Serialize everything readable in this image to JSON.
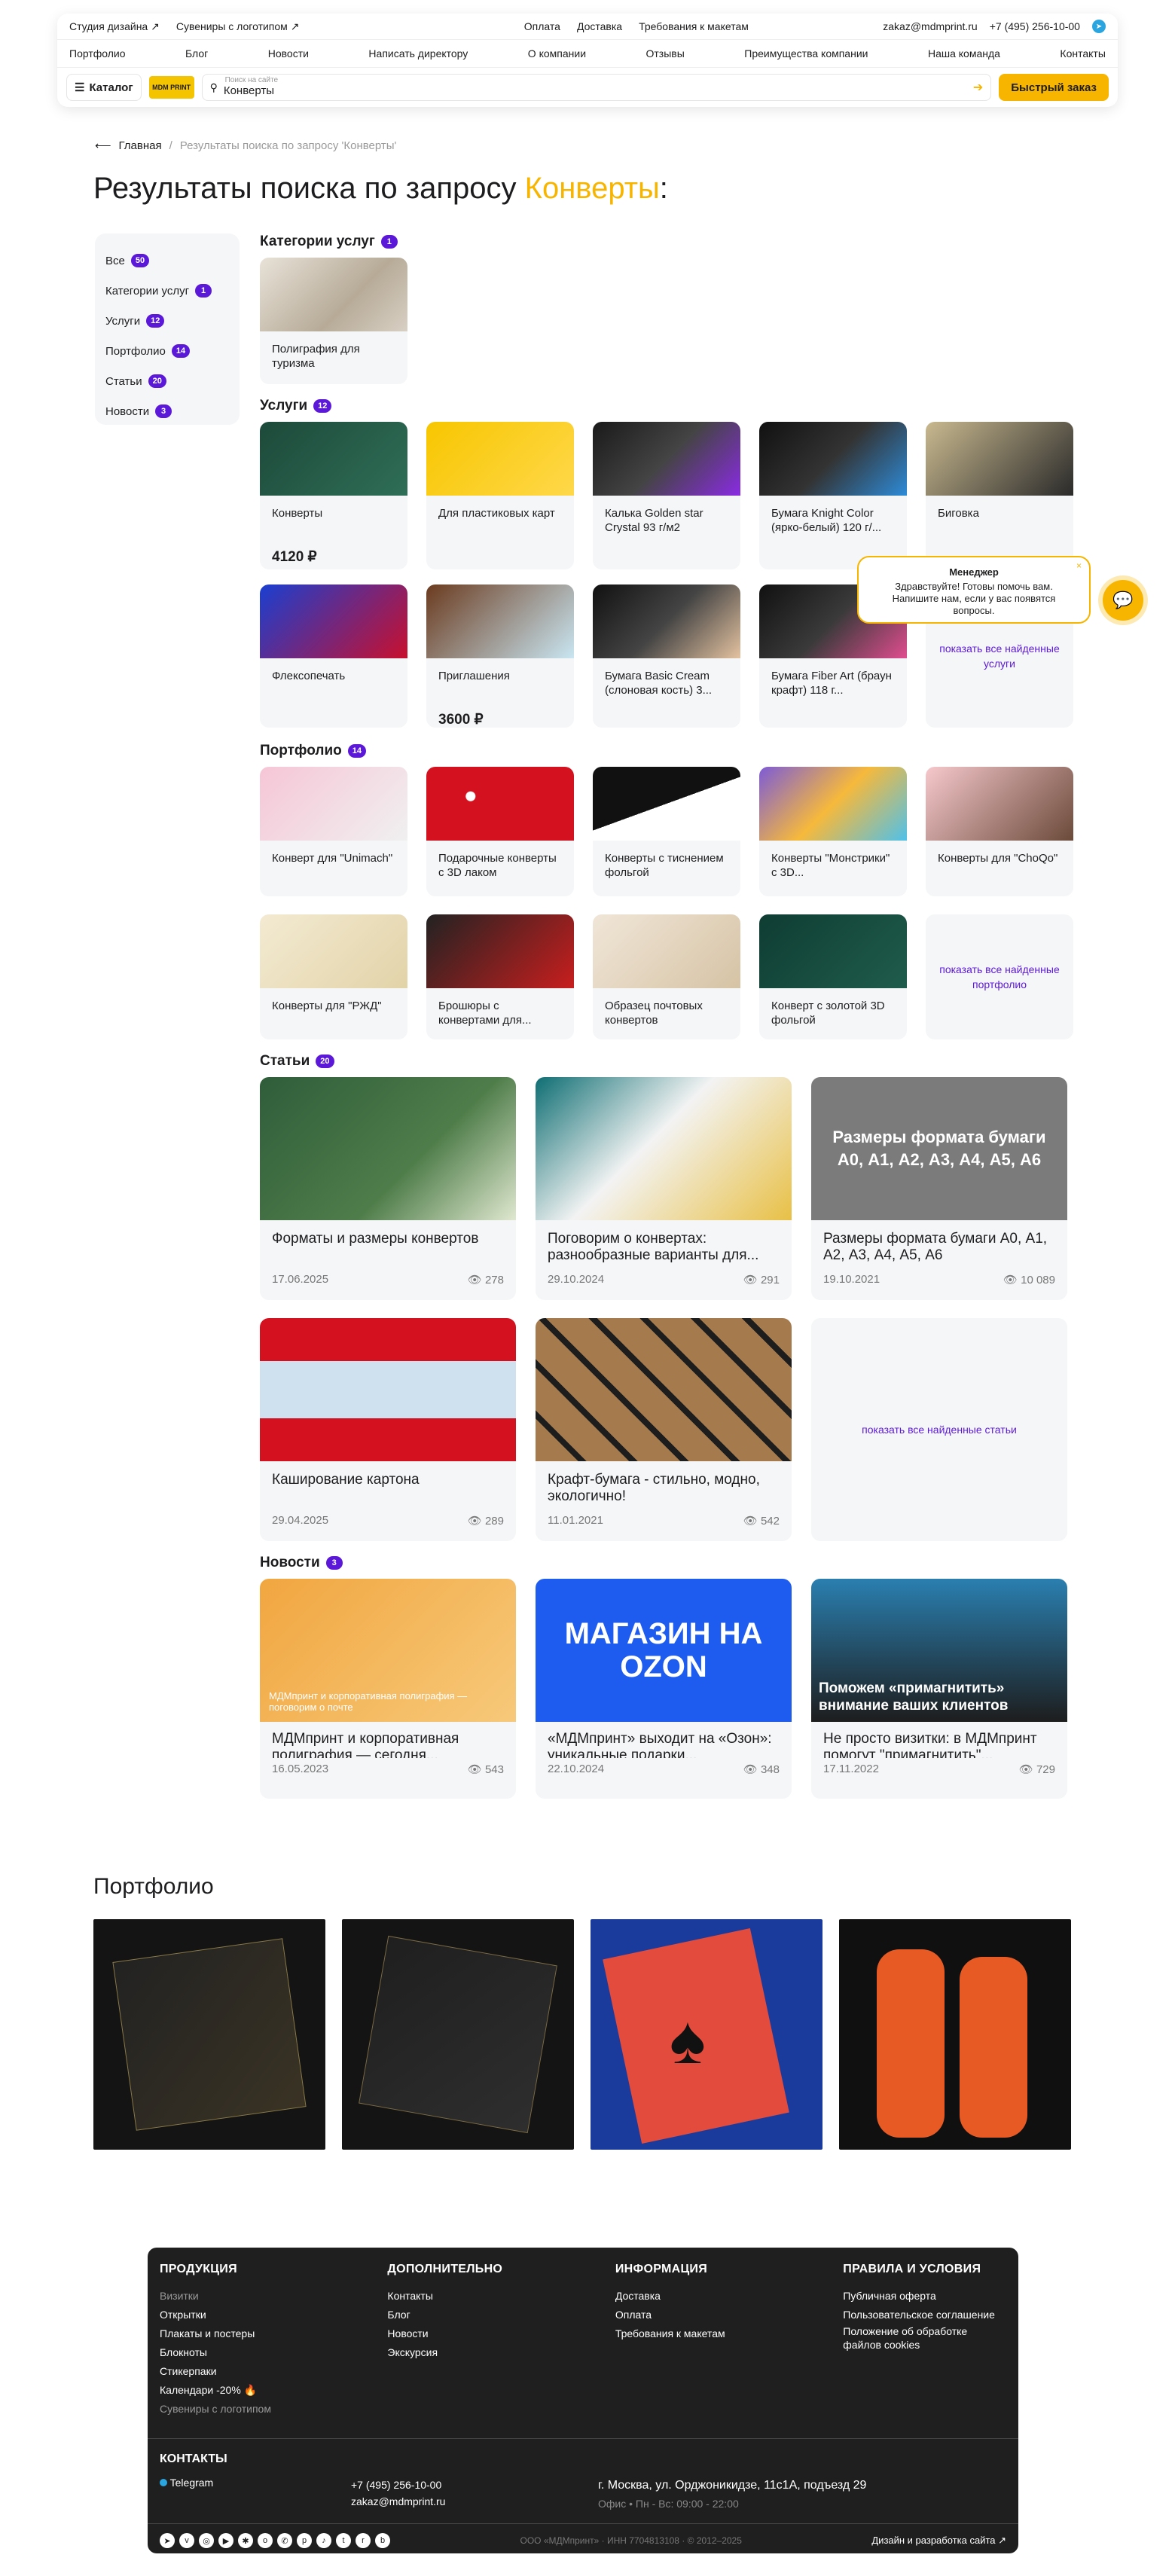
{
  "header": {
    "top_left": [
      "Студия дизайна ↗",
      "Сувениры с логотипом ↗"
    ],
    "top_mid": [
      "Оплата",
      "Доставка",
      "Требования к макетам"
    ],
    "email": "zakaz@mdmprint.ru",
    "phone": "+7 (495) 256-10-00",
    "nav": [
      "Портфолио",
      "Блог",
      "Новости",
      "Написать директору",
      "О компании",
      "Отзывы",
      "Преимущества компании",
      "Наша команда",
      "Контакты"
    ],
    "catalog_label": "Каталог",
    "logo_text": "MDM PRINT",
    "search_placeholder": "Поиск на сайте",
    "search_value": "Конверты",
    "fast_order": "Быстрый заказ"
  },
  "breadcrumb": {
    "home": "Главная",
    "sep": "/",
    "current": "Результаты поиска по запросу 'Конверты'"
  },
  "heading": {
    "prefix": "Результаты поиска по запросу ",
    "query": "Конверты",
    "suffix": ":"
  },
  "filters": [
    {
      "label": "Все",
      "count": "50"
    },
    {
      "label": "Категории услуг",
      "count": "1"
    },
    {
      "label": "Услуги",
      "count": "12"
    },
    {
      "label": "Портфолио",
      "count": "14"
    },
    {
      "label": "Статьи",
      "count": "20"
    },
    {
      "label": "Новости",
      "count": "3"
    }
  ],
  "categories": {
    "title": "Категории услуг",
    "count": "1",
    "items": [
      {
        "title": "Полиграфия для туризма"
      }
    ]
  },
  "services": {
    "title": "Услуги",
    "count": "12",
    "items": [
      {
        "title": "Конверты",
        "price": "4120 ₽"
      },
      {
        "title": "Для пластиковых карт",
        "price": ""
      },
      {
        "title": "Калька Golden star Crystal 93 г/м2",
        "price": ""
      },
      {
        "title": "Бумага Knight Color (ярко-белый) 120 г/...",
        "price": ""
      },
      {
        "title": "Биговка",
        "price": ""
      },
      {
        "title": "Флексопечать",
        "price": ""
      },
      {
        "title": "Приглашения",
        "price": "3600 ₽"
      },
      {
        "title": "Бумага Basic Cream (слоновая кость) 3...",
        "price": ""
      },
      {
        "title": "Бумага Fiber Art (браун крафт) 118 г...",
        "price": ""
      }
    ],
    "more": "показать все найденные услуги"
  },
  "portfolio_results": {
    "title": "Портфолио",
    "count": "14",
    "items": [
      {
        "title": "Конверт для \"Unimach\""
      },
      {
        "title": "Подарочные конверты с 3D лаком"
      },
      {
        "title": "Конверты с тиснением фольгой"
      },
      {
        "title": "Конверты \"Монстрики\" с 3D..."
      },
      {
        "title": "Конверты для \"ChoQo\""
      },
      {
        "title": "Конверты для \"РЖД\""
      },
      {
        "title": "Брошюры с конвертами для..."
      },
      {
        "title": "Образец почтовых конвертов"
      },
      {
        "title": "Конверт с золотой 3D фольгой"
      }
    ],
    "more": "показать все найденные портфолио"
  },
  "articles": {
    "title": "Статьи",
    "count": "20",
    "items": [
      {
        "title": "Форматы и размеры конвертов",
        "date": "17.06.2025",
        "views": "278"
      },
      {
        "title": "Поговорим о конвертах: разнообразные варианты для...",
        "date": "29.10.2024",
        "views": "291"
      },
      {
        "title": "Размеры формата бумаги А0, А1, А2, А3, А4, А5, А6",
        "date": "19.10.2021",
        "views": "10 089",
        "img_text": "Размеры формата бумаги А0, А1, А2, А3, А4, А5, А6"
      },
      {
        "title": "Каширование картона",
        "date": "29.04.2025",
        "views": "289"
      },
      {
        "title": "Крафт-бумага - стильно, модно, экологично!",
        "date": "11.01.2021",
        "views": "542"
      }
    ],
    "more": "показать все найденные статьи"
  },
  "news": {
    "title": "Новости",
    "count": "3",
    "items": [
      {
        "title": "МДМпринт и корпоративная полиграфия — сегодня...",
        "date": "16.05.2023",
        "views": "543",
        "img_text": "МДМпринт и корпоративная полиграфия — поговорим о почте"
      },
      {
        "title": "«МДМпринт» выходит на «Озон»: уникальные подарки...",
        "date": "22.10.2024",
        "views": "348",
        "img_text": "МАГАЗИН НА OZON"
      },
      {
        "title": "Не просто визитки: в МДМпринт помогут \"примагнитить\"...",
        "date": "17.11.2022",
        "views": "729",
        "img_text": "Поможем «примагнитить» внимание ваших клиентов"
      }
    ]
  },
  "portfolio_section": {
    "title": "Портфолио"
  },
  "chat": {
    "title": "Менеджер",
    "text": "Здравствуйте! Готовы помочь вам. Напишите нам, если у вас появятся вопросы."
  },
  "footer": {
    "cols": [
      {
        "title": "ПРОДУКЦИЯ",
        "items": [
          "Визитки",
          "Открытки",
          "Плакаты и постеры",
          "Блокноты",
          "Стикерпаки",
          "Календари -20% 🔥",
          "Сувениры с логотипом"
        ]
      },
      {
        "title": "ДОПОЛНИТЕЛЬНО",
        "items": [
          "Контакты",
          "Блог",
          "Новости",
          "Экскурсия"
        ]
      },
      {
        "title": "ИНФОРМАЦИЯ",
        "items": [
          "Доставка",
          "Оплата",
          "Требования к макетам"
        ]
      },
      {
        "title": "ПРАВИЛА И УСЛОВИЯ",
        "items": [
          "Публичная оферта",
          "Пользовательское соглашение",
          "Положение об обработке файлов cookies"
        ]
      }
    ],
    "contacts_title": "КОНТАКТЫ",
    "telegram": "Telegram",
    "phone": "+7 (495) 256-10-00",
    "email": "zakaz@mdmprint.ru",
    "address": "г. Москва, ул. Орджоникидзе, 11с1А, подъезд 29",
    "hours": "Офис • Пн - Вс: 09:00 - 22:00",
    "legal": "ООО «МДМпринт» · ИНН 7704813108 · © 2012–2025",
    "credit": "Дизайн и разработка сайта ↗"
  }
}
